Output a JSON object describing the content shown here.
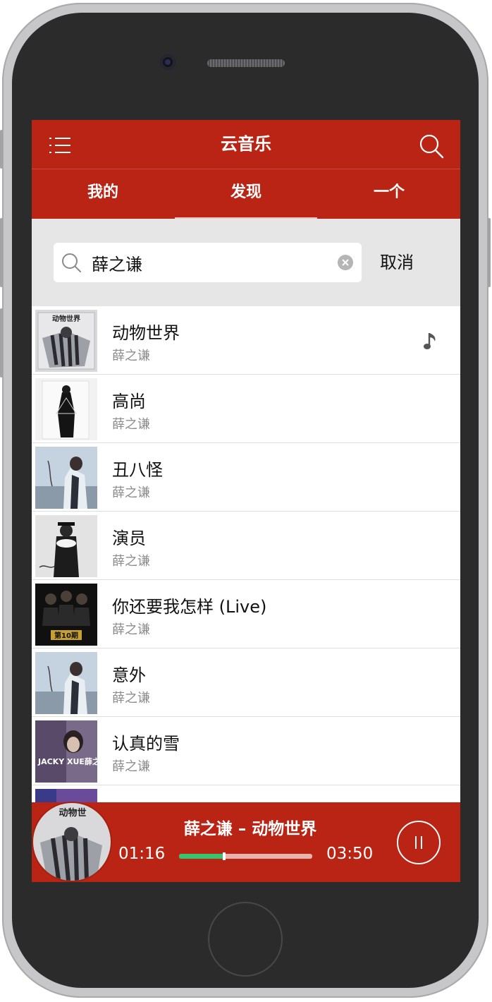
{
  "app": {
    "title": "云音乐"
  },
  "tabs": [
    {
      "label": "我的"
    },
    {
      "label": "发现",
      "active": true
    },
    {
      "label": "一个"
    }
  ],
  "search": {
    "value": "薛之谦",
    "cancel_label": "取消"
  },
  "songs": [
    {
      "title": "动物世界",
      "artist": "薛之谦",
      "cover_text": "动物世界",
      "playing": true
    },
    {
      "title": "高尚",
      "artist": "薛之谦"
    },
    {
      "title": "丑八怪",
      "artist": "薛之谦"
    },
    {
      "title": "演员",
      "artist": "薛之谦"
    },
    {
      "title": "你还要我怎样 (Live)",
      "artist": "薛之谦",
      "cover_text": "第10期"
    },
    {
      "title": "意外",
      "artist": "薛之谦"
    },
    {
      "title": "认真的雪",
      "artist": "薛之谦",
      "cover_text": "JACKY XUE薛之谦"
    }
  ],
  "player": {
    "now_playing": "薛之谦 – 动物世界",
    "current_time": "01:16",
    "total_time": "03:50",
    "progress": 0.34,
    "cover_text": "动物世"
  },
  "colors": {
    "brand_red": "#b92414",
    "progress_green": "#37c46e",
    "search_bg": "#e6e6e6"
  },
  "icons": {
    "menu": "menu-icon",
    "search": "search-icon",
    "clear": "clear-icon",
    "note": "music-note-icon",
    "pause": "pause-icon"
  }
}
